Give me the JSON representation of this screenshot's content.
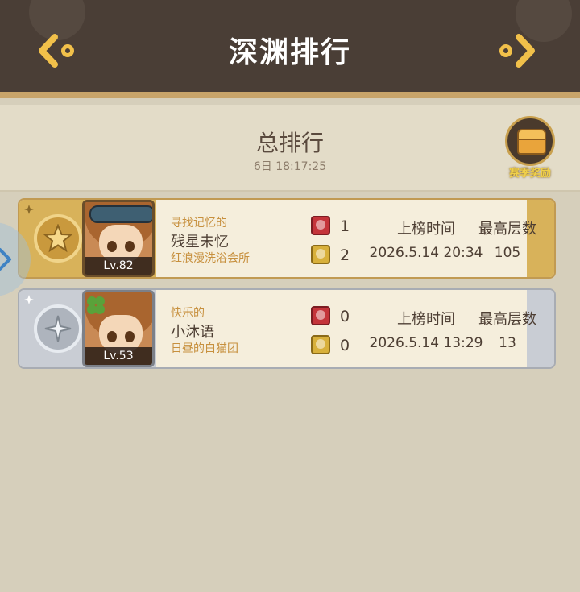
{
  "header": {
    "title": "深渊排行"
  },
  "subheader": {
    "title": "总排行",
    "timer": "6日 18:17:25"
  },
  "reward": {
    "label": "赛季奖励"
  },
  "columns": {
    "time_header": "上榜时间",
    "floor_header": "最高层数"
  },
  "rankings": [
    {
      "rank_type": "gold",
      "level": "Lv.82",
      "title_tag": "寻找记忆的",
      "name": "残星未忆",
      "guild": "红浪漫洗浴会所",
      "red_gems": "1",
      "yellow_gems": "2",
      "time": "2026.5.14 20:34",
      "floor": "105"
    },
    {
      "rank_type": "silver",
      "level": "Lv.53",
      "title_tag": "快乐的",
      "name": "小沐语",
      "guild": "日昼的白猫团",
      "red_gems": "0",
      "yellow_gems": "0",
      "time": "2026.5.14 13:29",
      "floor": "13"
    }
  ],
  "colors": {
    "header_bg": "#4a3e36",
    "gold": "#d8b25a",
    "silver": "#c9cdd4",
    "page_bg": "#d6cfbb"
  },
  "icons": {
    "back": "chevron-left-gear-icon",
    "forward": "chevron-right-gear-icon",
    "reward": "treasure-chest-icon",
    "gold_medal": "star-medal-icon",
    "silver_medal": "compass-star-medal-icon",
    "red_gem": "red-gem-icon",
    "yellow_gem": "yellow-gem-icon",
    "side_tab": "chevron-right-icon"
  }
}
